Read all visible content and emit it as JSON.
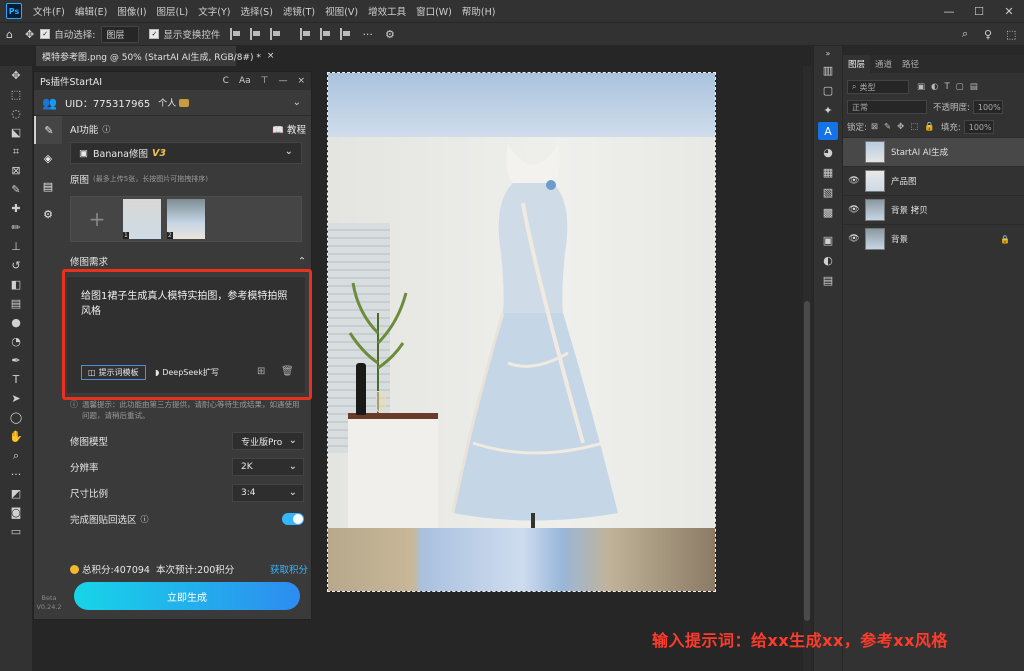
{
  "menubar": {
    "items": [
      "文件(F)",
      "编辑(E)",
      "图像(I)",
      "图层(L)",
      "文字(Y)",
      "选择(S)",
      "滤镜(T)",
      "视图(V)",
      "增效工具",
      "窗口(W)",
      "帮助(H)"
    ],
    "logo": "Ps"
  },
  "optbar": {
    "auto_select_label": "自动选择:",
    "auto_select_value": "图层",
    "transform_label": "显示变换控件"
  },
  "document": {
    "tab_title": "模特参考图.png @ 50% (StartAI AI生成, RGB/8#) *",
    "close": "×"
  },
  "plugin": {
    "title": "Ps插件StartAI",
    "header_icons": [
      "C",
      "Aa",
      "⊤",
      "—",
      "×"
    ],
    "uid": "UID：775317965",
    "account_type": "个人",
    "ai_function_label": "AI功能",
    "tutorial_label": "教程",
    "model_select": "Banana修图",
    "model_version": "V3",
    "original_label": "原图",
    "original_hint": "(最多上传5张，长按图片可拖拽排序)",
    "thumb_nums": [
      "1",
      "2"
    ],
    "request_label": "修图需求",
    "prompt_text": "给图1裙子生成真人模特实拍图，参考模特拍照风格",
    "template_btn": "提示词模板",
    "deepseek_btn": "DeepSeek扩写",
    "notice": "温馨提示：此功能由第三方提供，请耐心等待生成结果，如遇使用问题，请稍后重试。",
    "options": {
      "model_label": "修图模型",
      "model_value": "专业版Pro",
      "resolution_label": "分辨率",
      "resolution_value": "2K",
      "ratio_label": "尺寸比例",
      "ratio_value": "3:4",
      "paste_label": "完成图贴回选区"
    },
    "credits_total": "总积分:407094",
    "credits_cost": "本次预计:200积分",
    "get_credits": "获取积分",
    "generate_btn": "立即生成",
    "beta": "Beta",
    "version": "V0.24.2"
  },
  "layers_panel": {
    "tabs": [
      "图层",
      "通道",
      "路径"
    ],
    "filter_label": "类型",
    "blend_mode": "正常",
    "opacity_label": "不透明度:",
    "opacity_value": "100%",
    "lock_label": "锁定:",
    "fill_label": "填充:",
    "fill_value": "100%",
    "layers": [
      {
        "name": "StartAI AI生成",
        "selected": true,
        "visible": false,
        "locked": false
      },
      {
        "name": "产品图",
        "selected": false,
        "visible": true,
        "locked": false
      },
      {
        "name": "背景 拷贝",
        "selected": false,
        "visible": true,
        "locked": false
      },
      {
        "name": "背景",
        "selected": false,
        "visible": true,
        "locked": true
      }
    ]
  },
  "caption": "输入提示词：给xx生成xx，参考xx风格",
  "colors": {
    "accent": "#35b7ff",
    "highlight_frame": "#e8311f",
    "version_tag": "#f2c14e"
  }
}
